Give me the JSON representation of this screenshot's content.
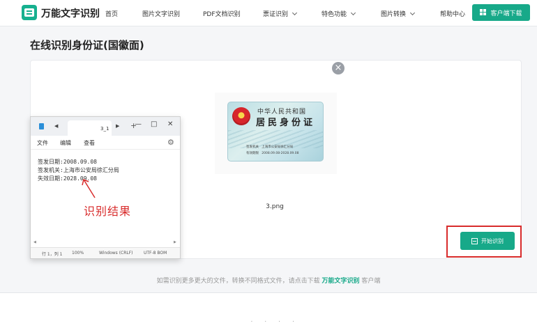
{
  "header": {
    "brand": "万能文字识别",
    "nav": [
      {
        "label": "首页"
      },
      {
        "label": "图片文字识别"
      },
      {
        "label": "PDF文档识别"
      },
      {
        "label": "票证识别"
      },
      {
        "label": "特色功能"
      },
      {
        "label": "图片转换"
      },
      {
        "label": "帮助中心"
      }
    ],
    "download_label": "客户端下载"
  },
  "page": {
    "title": "在线识别身份证(国徽面)",
    "file_name": "3.png",
    "close_icon": "×",
    "start_label": "开始识别",
    "footer": {
      "prefix": "如需识别更多更大的文件，转换不同格式文件，请点击下载",
      "brand": "万能文字识别",
      "suffix": "客户端"
    },
    "bottom_dots": "· · · ·"
  },
  "id_card": {
    "country": "中华人民共和国",
    "title": "居民身份证",
    "issuer_label": "签发机关",
    "issuer_value": "上海市公安局徐汇分局",
    "validity_label": "有效期限",
    "validity_value": "2008.09.08-2028.09.08"
  },
  "notepad": {
    "tab_title": "3_1",
    "menu": [
      "文件",
      "编辑",
      "查看"
    ],
    "lines": [
      "签发日期:2008.09.08",
      "签发机关:上海市公安局徐汇分局",
      "失效日期:2028.09.08"
    ],
    "status": {
      "position": "行 1，列 1",
      "zoom": "100%",
      "line_ending": "Windows (CRLF)",
      "encoding": "UTF-8 BOM"
    }
  },
  "annotation": {
    "label": "识别结果",
    "color": "#d82b2b"
  },
  "colors": {
    "accent": "#17a989",
    "highlight": "#d82b2b"
  }
}
